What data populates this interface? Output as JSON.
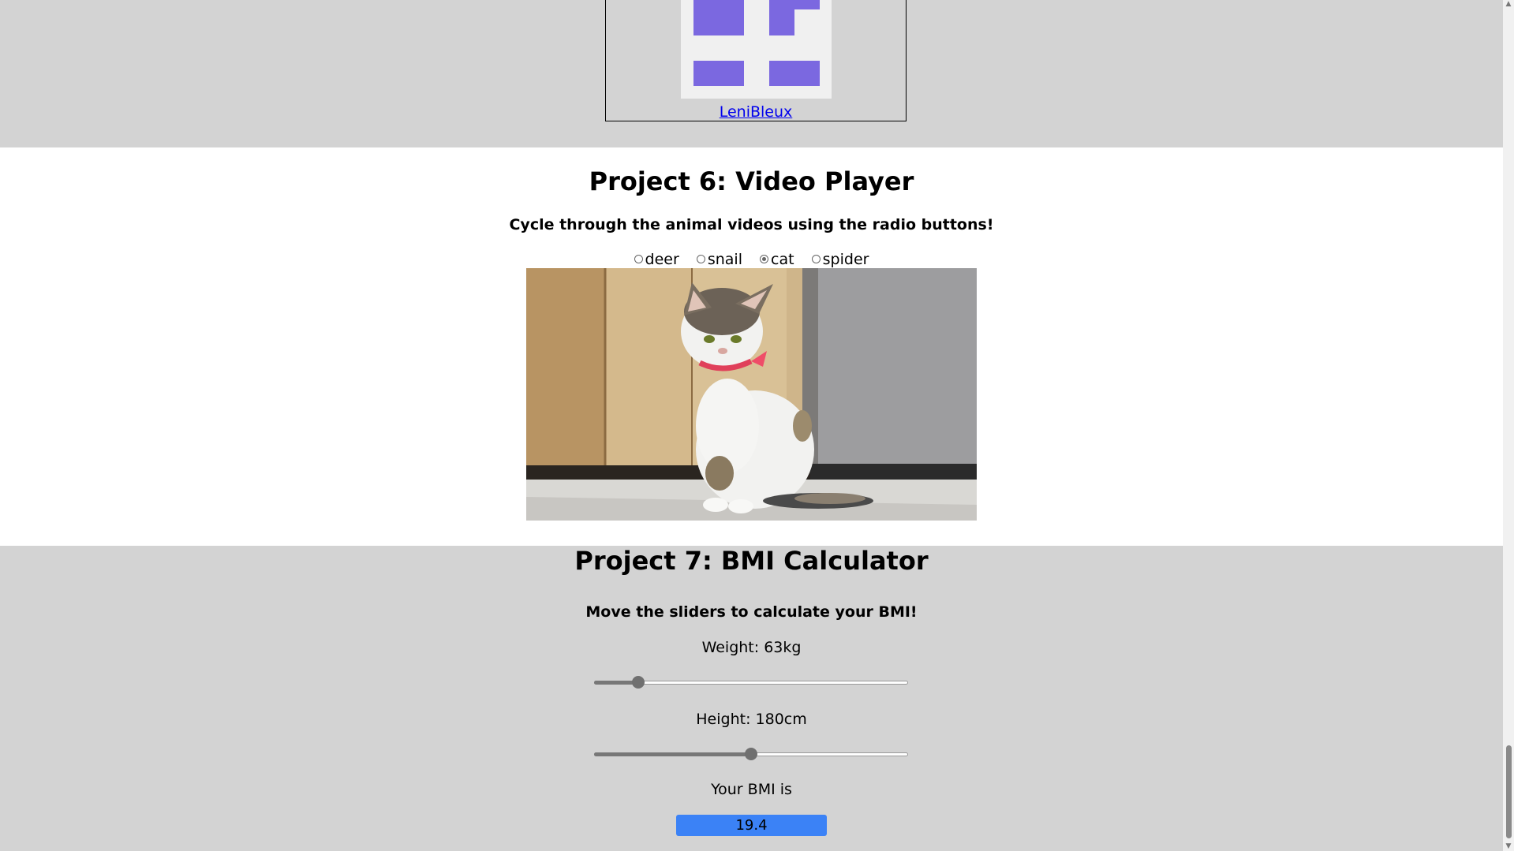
{
  "avatar": {
    "username": "LeniBleux",
    "identicon_color": "#7b68e0"
  },
  "video_player": {
    "title": "Project 6: Video Player",
    "subtitle": "Cycle through the animal videos using the radio buttons!",
    "options": [
      "deer",
      "snail",
      "cat",
      "spider"
    ],
    "selected": "cat"
  },
  "bmi": {
    "title": "Project 7: BMI Calculator",
    "subtitle": "Move the sliders to calculate your BMI!",
    "weight_label": "Weight: 63kg",
    "weight_fraction": 0.14,
    "height_label": "Height: 180cm",
    "height_fraction": 0.5,
    "result_label": "Your BMI is",
    "result_value": "19.4",
    "result_color": "#3b82f6"
  }
}
